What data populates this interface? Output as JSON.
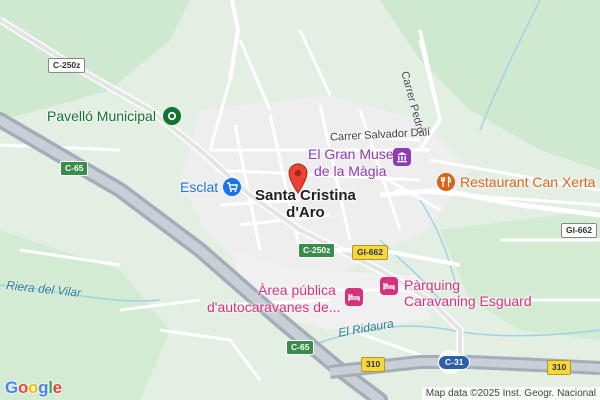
{
  "map": {
    "town": {
      "line1": "Santa Cristina",
      "line2": "d'Aro"
    },
    "pois": {
      "pavello": "Pavelló Municipal",
      "museu_1": "El Gran Museu",
      "museu_2": "de la Màgia",
      "esclat": "Esclat",
      "restaurant": "Restaurant Can Xerta",
      "area_1": "Àrea pública",
      "area_2": "d'autocaravanes de...",
      "parquing_1": "Pàrquing",
      "parquing_2": "Caravaning Esguard"
    },
    "streets": {
      "salvador_dali": "Carrer Salvador Dalí",
      "pedro": "Carrer Pedró",
      "riera_vilar": "Riera del Vilar",
      "ridaura": "El Ridaura"
    },
    "shields": {
      "c250z_top": "C-250z",
      "c65_left": "C-65",
      "c250z_mid": "C-250z",
      "gi662_mid": "GI-662",
      "gi662_right": "GI-662",
      "c65_bottom": "C-65",
      "s310_left": "310",
      "c31": "C-31",
      "s310_right": "310"
    },
    "icons": {
      "pin": "map-pin-icon",
      "pavello": "park-icon",
      "museu": "museum-icon",
      "esclat": "shopping-cart-icon",
      "restaurant": "restaurant-icon",
      "area": "lodging-icon",
      "parquing": "lodging-icon"
    },
    "colors": {
      "park_green": "#137333",
      "museum_purple": "#8e3bb7",
      "restaurant_orange": "#d9631a",
      "shop_blue": "#1a73e8",
      "lodging_pink": "#d4337a",
      "pin_red": "#ea4335"
    }
  },
  "footer": {
    "logo": "Google",
    "attribution": "Map data ©2025 Inst. Geogr. Nacional"
  }
}
